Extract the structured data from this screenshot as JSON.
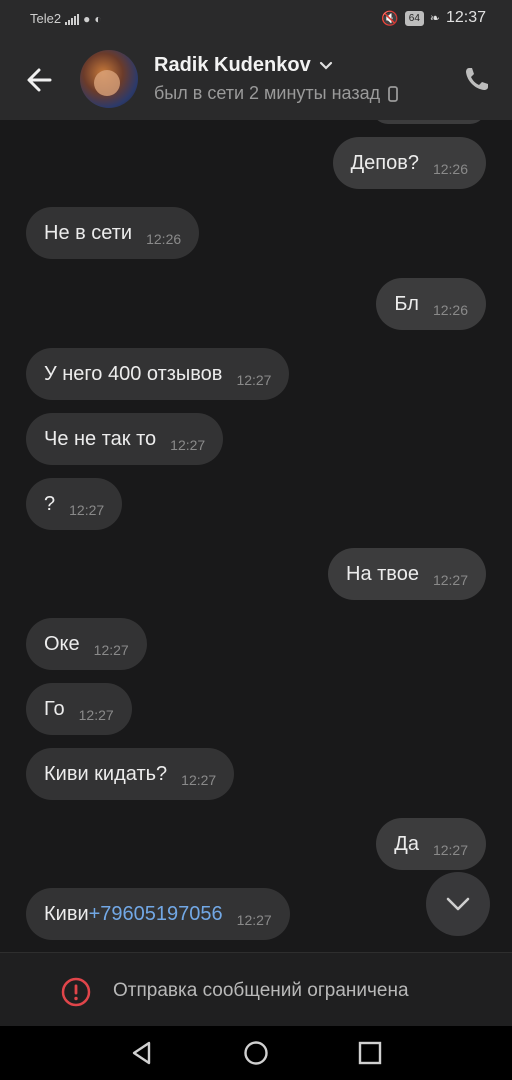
{
  "status_bar": {
    "carrier": "Tele2",
    "battery": "64",
    "time": "12:37"
  },
  "header": {
    "contact_name": "Radik Kudenkov",
    "last_seen": "был в сети 2 минуты назад"
  },
  "messages": [
    {
      "dir": "out",
      "text": "Депов?",
      "time": "12:26"
    },
    {
      "dir": "in",
      "text": "Не в сети",
      "time": "12:26"
    },
    {
      "dir": "out",
      "text": "Бл",
      "time": "12:26"
    },
    {
      "dir": "in",
      "text": "У него 400 отзывов",
      "time": "12:27"
    },
    {
      "dir": "in",
      "text": "Че не так то",
      "time": "12:27"
    },
    {
      "dir": "in",
      "text": "?",
      "time": "12:27"
    },
    {
      "dir": "out",
      "text": "На твое",
      "time": "12:27"
    },
    {
      "dir": "in",
      "text": "Оке",
      "time": "12:27"
    },
    {
      "dir": "in",
      "text": "Го",
      "time": "12:27"
    },
    {
      "dir": "in",
      "text": "Киви кидать?",
      "time": "12:27"
    },
    {
      "dir": "out",
      "text": "Да",
      "time": "12:27"
    },
    {
      "dir": "in",
      "text": "Киви ",
      "link": "+79605197056",
      "time": "12:27"
    }
  ],
  "footer": {
    "restricted_text": "Отправка сообщений ограничена"
  },
  "colors": {
    "background": "#19191a",
    "header": "#2a2a2b",
    "bubble_in": "#333334",
    "bubble_out": "#3c3c3d",
    "link": "#72a8e6",
    "warning": "#e0454a"
  }
}
